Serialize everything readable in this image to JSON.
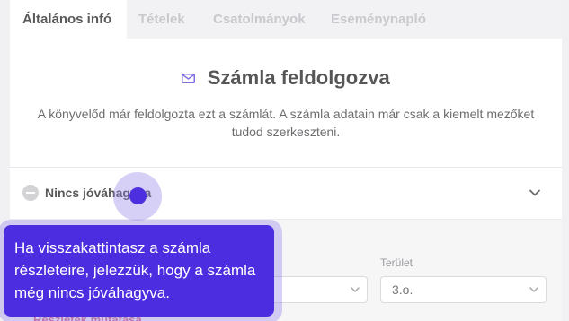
{
  "tabs": [
    {
      "label": "Általános infó",
      "active": true
    },
    {
      "label": "Tételek",
      "active": false
    },
    {
      "label": "Csatolmányok",
      "active": false
    },
    {
      "label": "Eseménynapló",
      "active": false
    }
  ],
  "header": {
    "icon": "mail-icon",
    "title": "Számla feldolgozva",
    "description": "A könyvelőd már feldolgozta ezt a számlát. A számla adatain már csak a kiemelt mezőket tudod szerkeszteni."
  },
  "status": {
    "icon": "minus-circle-icon",
    "label": "Nincs jóváhagyva",
    "expand_icon": "chevron-down-icon"
  },
  "form": {
    "field_label": "Terület",
    "field_value": "3.o.",
    "details_link": "Részletek mutatása"
  },
  "tooltip": {
    "text": "Ha visszakattintasz a számla részleteire, jelezzük, hogy a számla még nincs jóváhagyva."
  },
  "colors": {
    "accent": "#4c2de0",
    "link": "#c24a62",
    "muted_tab": "#b7b7bd"
  }
}
